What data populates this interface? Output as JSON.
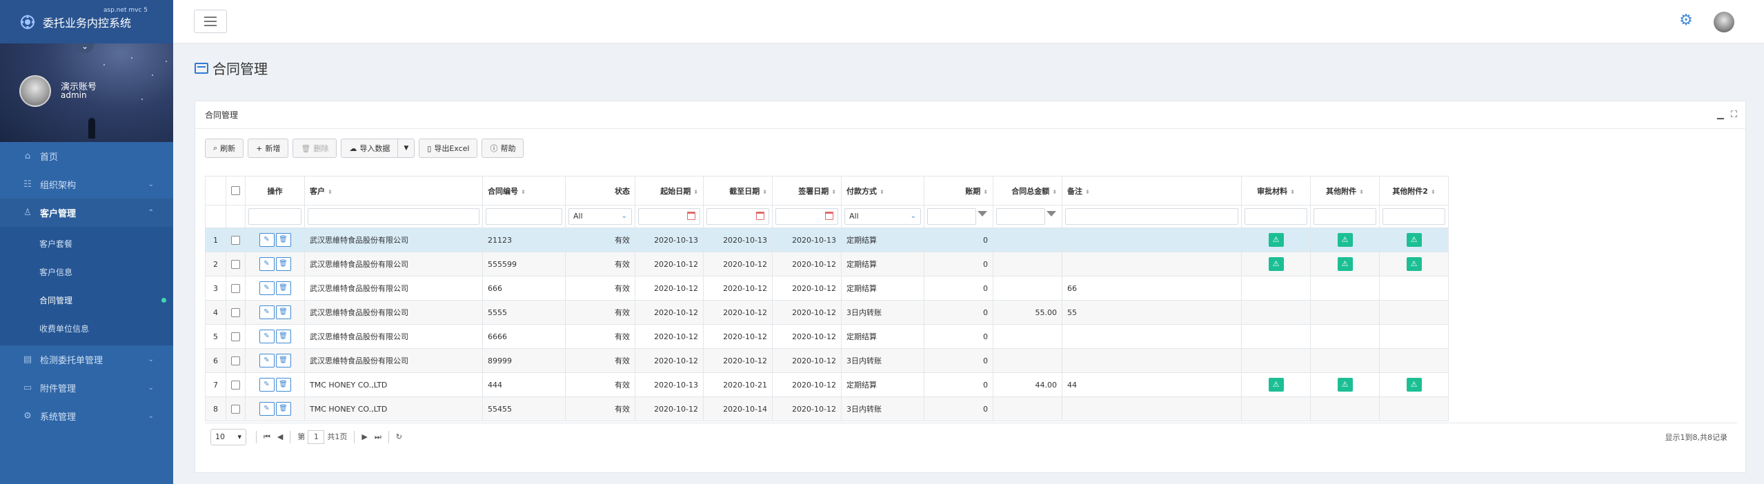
{
  "app": {
    "title": "委托业务内控系统",
    "version": "asp.net mvc 5"
  },
  "user": {
    "display_name": "演示账号",
    "account": "admin"
  },
  "sidebar": {
    "items": [
      {
        "label": "首页",
        "icon": "home-icon"
      },
      {
        "label": "组织架构",
        "icon": "org-icon"
      },
      {
        "label": "客户管理",
        "icon": "user-icon"
      },
      {
        "label": "检测委托单管理",
        "icon": "clipboard-icon"
      },
      {
        "label": "附件管理",
        "icon": "folder-icon"
      },
      {
        "label": "系统管理",
        "icon": "gear-icon"
      }
    ],
    "submenu": [
      {
        "label": "客户套餐"
      },
      {
        "label": "客户信息"
      },
      {
        "label": "合同管理"
      },
      {
        "label": "收费单位信息"
      }
    ]
  },
  "page": {
    "title": "合同管理"
  },
  "panel": {
    "title": "合同管理"
  },
  "toolbar": {
    "refresh": "刷新",
    "add": "新增",
    "delete": "删除",
    "import": "导入数据",
    "export": "导出Excel",
    "help": "帮助"
  },
  "table": {
    "headers": {
      "op": "操作",
      "customer": "客户",
      "contract_no": "合同编号",
      "status": "状态",
      "start": "起始日期",
      "end": "截至日期",
      "sign": "签署日期",
      "pay": "付款方式",
      "period": "账期",
      "total": "合同总金额",
      "note": "备注",
      "audit": "审批材料",
      "att1": "其他附件",
      "att2": "其他附件2"
    },
    "filters": {
      "status": "All",
      "pay": "All"
    },
    "rows": [
      {
        "no": "1",
        "customer": "武汉思維特食品股份有限公司",
        "contract_no": "21123",
        "status": "有效",
        "start": "2020-10-13",
        "end": "2020-10-13",
        "sign": "2020-10-13",
        "pay": "定期结算",
        "period": "0",
        "total": "",
        "note": "",
        "has_files": true
      },
      {
        "no": "2",
        "customer": "武汉思維特食品股份有限公司",
        "contract_no": "555599",
        "status": "有效",
        "start": "2020-10-12",
        "end": "2020-10-12",
        "sign": "2020-10-12",
        "pay": "定期结算",
        "period": "0",
        "total": "",
        "note": "",
        "has_files": true
      },
      {
        "no": "3",
        "customer": "武汉思維特食品股份有限公司",
        "contract_no": "666",
        "status": "有效",
        "start": "2020-10-12",
        "end": "2020-10-12",
        "sign": "2020-10-12",
        "pay": "定期结算",
        "period": "0",
        "total": "",
        "note": "66",
        "has_files": false
      },
      {
        "no": "4",
        "customer": "武汉思維特食品股份有限公司",
        "contract_no": "5555",
        "status": "有效",
        "start": "2020-10-12",
        "end": "2020-10-12",
        "sign": "2020-10-12",
        "pay": "3日内转账",
        "period": "0",
        "total": "55.00",
        "note": "55",
        "has_files": false
      },
      {
        "no": "5",
        "customer": "武汉思維特食品股份有限公司",
        "contract_no": "6666",
        "status": "有效",
        "start": "2020-10-12",
        "end": "2020-10-12",
        "sign": "2020-10-12",
        "pay": "定期结算",
        "period": "0",
        "total": "",
        "note": "",
        "has_files": false
      },
      {
        "no": "6",
        "customer": "武汉思維特食品股份有限公司",
        "contract_no": "89999",
        "status": "有效",
        "start": "2020-10-12",
        "end": "2020-10-12",
        "sign": "2020-10-12",
        "pay": "3日内转账",
        "period": "0",
        "total": "",
        "note": "",
        "has_files": false
      },
      {
        "no": "7",
        "customer": "TMC HONEY CO.,LTD",
        "contract_no": "444",
        "status": "有效",
        "start": "2020-10-13",
        "end": "2020-10-21",
        "sign": "2020-10-12",
        "pay": "定期结算",
        "period": "0",
        "total": "44.00",
        "note": "44",
        "has_files": true
      },
      {
        "no": "8",
        "customer": "TMC HONEY CO.,LTD",
        "contract_no": "55455",
        "status": "有效",
        "start": "2020-10-12",
        "end": "2020-10-14",
        "sign": "2020-10-12",
        "pay": "3日内转账",
        "period": "0",
        "total": "",
        "note": "",
        "has_files": false
      }
    ]
  },
  "pager": {
    "page_size": "10",
    "page_label_pre": "第",
    "page_current": "1",
    "page_label_post": "共1页",
    "info": "显示1到8,共8记录"
  },
  "colors": {
    "sidebar": "#2f66a8",
    "accent": "#3f8ad6",
    "file_button": "#1cbf93",
    "selected_row": "#d9ecf6"
  }
}
